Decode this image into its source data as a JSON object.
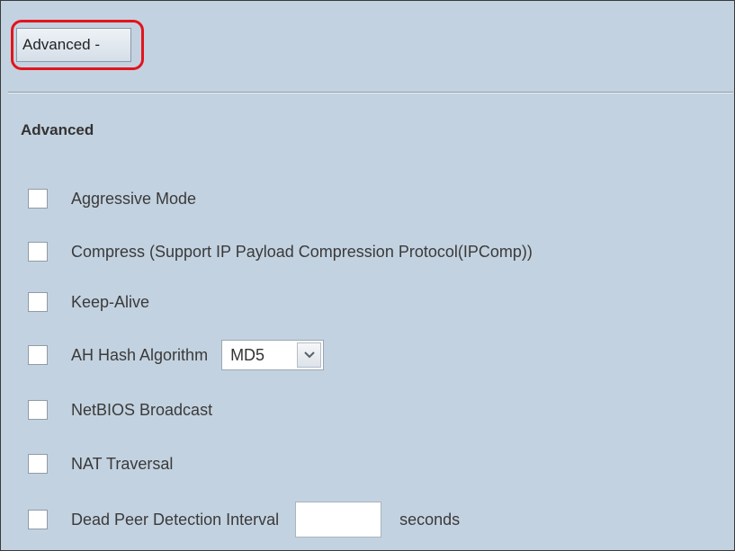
{
  "toggle_button": {
    "label": "Advanced -"
  },
  "section": {
    "title": "Advanced"
  },
  "options": {
    "aggressive_mode": {
      "label": "Aggressive Mode",
      "checked": false
    },
    "compress": {
      "label": "Compress (Support IP Payload Compression Protocol(IPComp))",
      "checked": false
    },
    "keep_alive": {
      "label": "Keep-Alive",
      "checked": false
    },
    "ah_hash": {
      "label": "AH Hash Algorithm",
      "checked": false,
      "selected": "MD5"
    },
    "netbios": {
      "label": "NetBIOS Broadcast",
      "checked": false
    },
    "nat_traversal": {
      "label": "NAT Traversal",
      "checked": false
    },
    "dpd": {
      "label": "Dead Peer Detection Interval",
      "checked": false,
      "value": "",
      "unit": "seconds"
    }
  },
  "colors": {
    "panel_background": "#c3d2e0",
    "highlight": "#e3141b"
  },
  "icons": {
    "dropdown": "chevron-down-icon"
  }
}
